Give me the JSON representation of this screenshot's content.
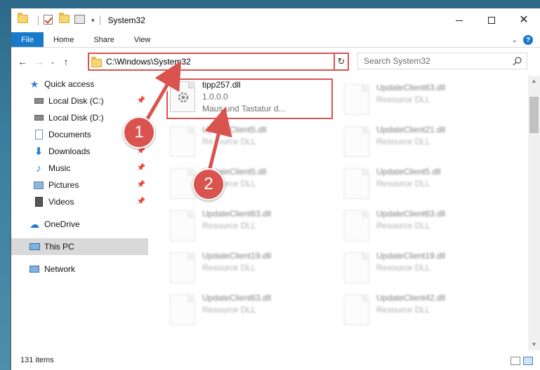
{
  "window": {
    "title": "System32",
    "caption": {
      "minimize": "minimize-icon",
      "maximize": "maximize-icon",
      "close": "close-icon"
    }
  },
  "ribbon": {
    "tabs": [
      "File",
      "Home",
      "Share",
      "View"
    ],
    "help_label": "?"
  },
  "address": {
    "path": "C:\\Windows\\System32",
    "search_placeholder": "Search System32"
  },
  "nav_pane": {
    "quick_access": "Quick access",
    "items": [
      {
        "label": "Local Disk (C:)",
        "pinned": true
      },
      {
        "label": "Local Disk (D:)",
        "pinned": false
      },
      {
        "label": "Documents",
        "pinned": true
      },
      {
        "label": "Downloads",
        "pinned": true
      },
      {
        "label": "Music",
        "pinned": true
      },
      {
        "label": "Pictures",
        "pinned": true
      },
      {
        "label": "Videos",
        "pinned": true
      }
    ],
    "onedrive": "OneDrive",
    "this_pc": "This PC",
    "network": "Network"
  },
  "files": {
    "selected": {
      "name": "tipp257.dll",
      "version": "1.0.0.0",
      "description": "Maus und Tastatur d..."
    },
    "left_column": [
      {
        "name": "UpdateClient5.dll",
        "type": "Resource DLL"
      },
      {
        "name": "UpdateClient5.dll",
        "type": "Resource DLL"
      },
      {
        "name": "UpdateClient63.dll",
        "type": "Resource DLL"
      },
      {
        "name": "UpdateClient19.dll",
        "type": "Resource DLL"
      },
      {
        "name": "UpdateClient63.dll",
        "type": "Resource DLL"
      }
    ],
    "right_column": [
      {
        "name": "UpdateClient63.dll",
        "type": "Resource DLL"
      },
      {
        "name": "UpdateClient21.dll",
        "type": "Resource DLL"
      },
      {
        "name": "UpdateClient5.dll",
        "type": "Resource DLL"
      },
      {
        "name": "UpdateClient63.dll",
        "type": "Resource DLL"
      },
      {
        "name": "UpdateClient19.dll",
        "type": "Resource DLL"
      },
      {
        "name": "UpdateClient42.dll",
        "type": "Resource DLL"
      }
    ]
  },
  "status": {
    "item_count": "131 items"
  },
  "annotations": {
    "step1": "1",
    "step2": "2",
    "color": "#d9534f"
  }
}
